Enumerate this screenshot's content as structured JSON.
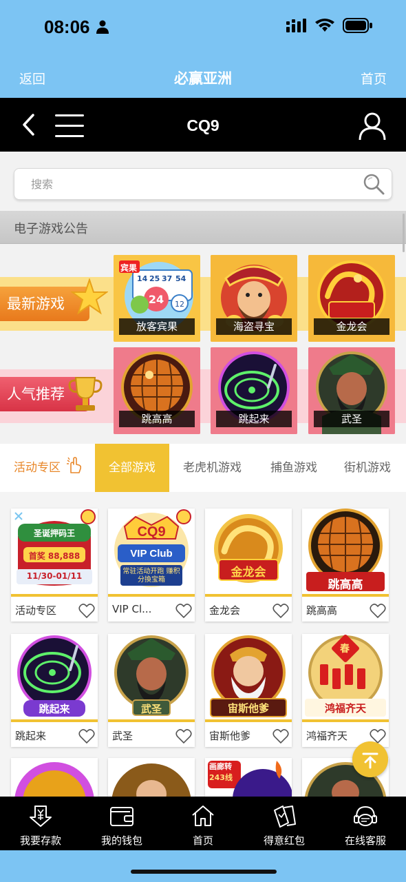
{
  "status_bar": {
    "time": "08:06"
  },
  "app_header": {
    "back": "返回",
    "title": "必赢亚洲",
    "home": "首页"
  },
  "nav": {
    "title": "CQ9"
  },
  "search": {
    "placeholder": "搜索"
  },
  "announcement": {
    "label": "电子游戏公告"
  },
  "featured": {
    "new_label": "最新游戏",
    "hot_label": "人气推荐",
    "new_games": [
      {
        "name": "放客宾果",
        "badge": "宾果"
      },
      {
        "name": "海盗寻宝"
      },
      {
        "name": "金龙会"
      }
    ],
    "hot_games": [
      {
        "name": "跳高高"
      },
      {
        "name": "跳起来"
      },
      {
        "name": "武圣"
      }
    ]
  },
  "tabs": {
    "activity": "活动专区",
    "all": "全部游戏",
    "slot": "老虎机游戏",
    "fish": "捕鱼游戏",
    "arcade": "街机游戏"
  },
  "games": [
    {
      "name": "活动专区",
      "art_text": "圣诞押码王",
      "art_sub": "首奖 88,888",
      "art_date": "11/30-01/11"
    },
    {
      "name": "VIP Cl...",
      "art_text": "CQ9",
      "art_sub": "VIP Club",
      "art_date": "常驻活动开跑 赚积分換宝箱"
    },
    {
      "name": "金龙会",
      "art_text": "金龙会"
    },
    {
      "name": "跳高高",
      "art_text": "跳高高"
    },
    {
      "name": "跳起来",
      "art_text": "跳起来"
    },
    {
      "name": "武圣",
      "art_text": "武圣"
    },
    {
      "name": "宙斯他爹",
      "art_text": "宙斯他爹"
    },
    {
      "name": "鸿福齐天",
      "art_text": "鸿福齐天",
      "art_sub": "春"
    }
  ],
  "partial_art": {
    "card3_badge_top": "画廊转",
    "card3_badge_bottom": "243线"
  },
  "bottom_tabs": [
    {
      "label": "我要存款",
      "icon": "deposit-icon"
    },
    {
      "label": "我的钱包",
      "icon": "wallet-icon"
    },
    {
      "label": "首页",
      "icon": "home-icon"
    },
    {
      "label": "得意红包",
      "icon": "red-packet-icon"
    },
    {
      "label": "在线客服",
      "icon": "customer-service-icon"
    }
  ],
  "colors": {
    "header_blue": "#7cc4f3",
    "accent_yellow": "#f1c232",
    "activity_orange": "#e8872a"
  }
}
